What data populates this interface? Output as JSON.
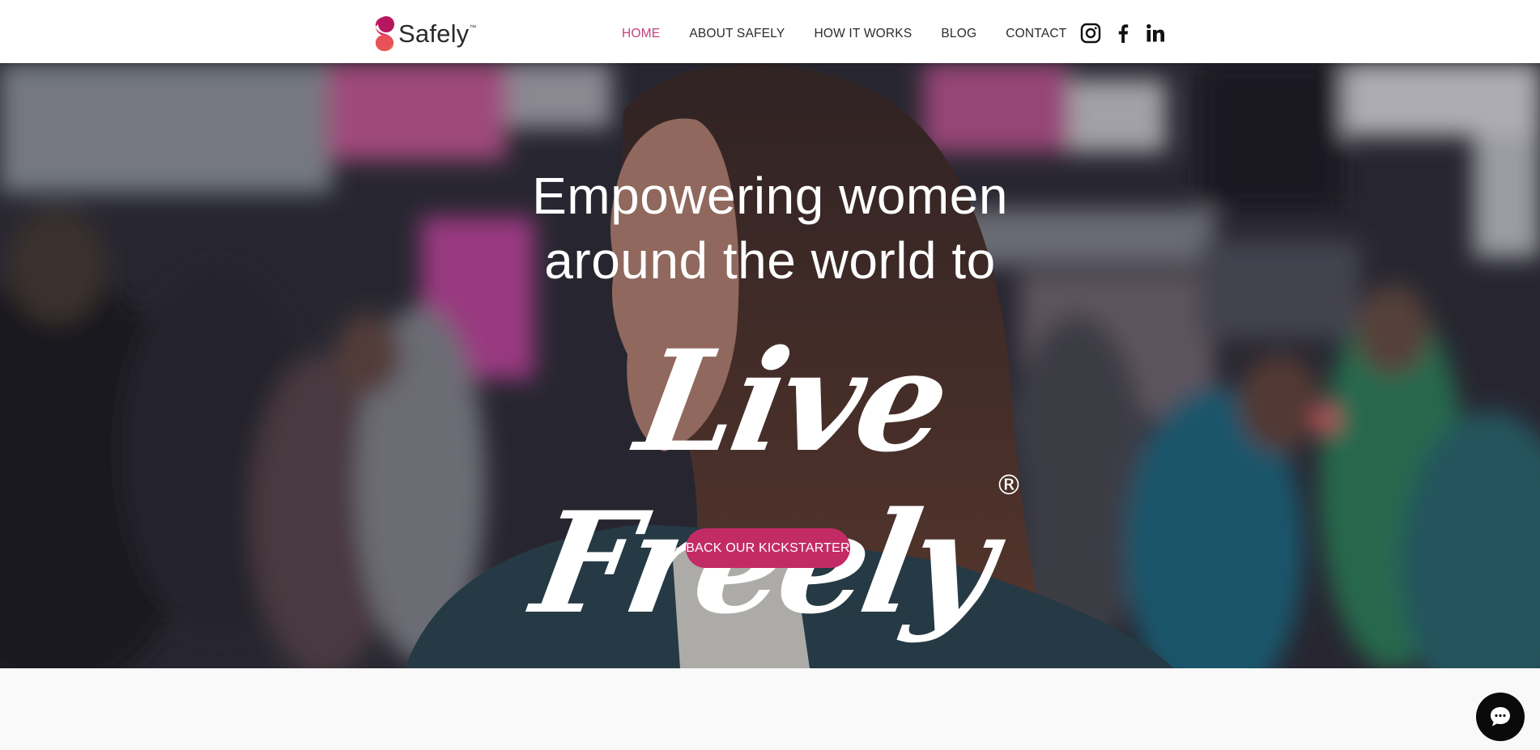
{
  "brand": {
    "name": "Safely",
    "tm": "™",
    "colors": {
      "primary": "#c32b66",
      "logo_gradient_top": "#b7175f",
      "logo_gradient_bottom": "#f08a3c"
    }
  },
  "nav": {
    "items": [
      {
        "label": "HOME",
        "active": true
      },
      {
        "label": "ABOUT SAFELY",
        "active": false
      },
      {
        "label": "HOW IT WORKS",
        "active": false
      },
      {
        "label": "BLOG",
        "active": false
      },
      {
        "label": "CONTACT",
        "active": false
      }
    ],
    "active_color": "#c4417c"
  },
  "social": [
    {
      "name": "instagram-icon"
    },
    {
      "name": "facebook-icon"
    },
    {
      "name": "linkedin-icon"
    }
  ],
  "hero": {
    "headline_line1": "Empowering women",
    "headline_line2": "around the world to",
    "script_text": "Live Freely",
    "registered": "®",
    "cta_label": "BACK OUR KICKSTARTER"
  },
  "chat": {
    "icon": "chat-bubble-icon"
  }
}
